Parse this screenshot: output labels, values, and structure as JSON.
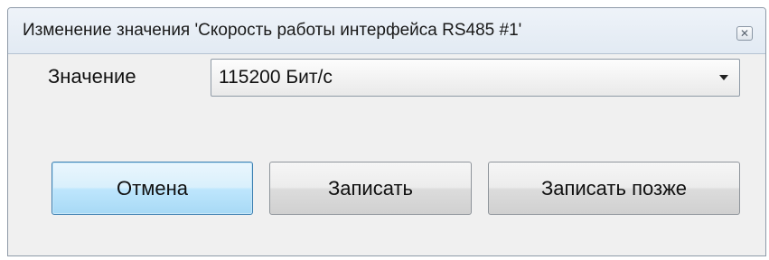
{
  "window": {
    "title": "Изменение значения 'Скорость работы интерфейса RS485 #1'",
    "close_icon": "close-icon"
  },
  "form": {
    "value_label": "Значение",
    "value_selected": "115200 Бит/с",
    "dropdown_icon": "chevron-down-icon"
  },
  "buttons": {
    "cancel": "Отмена",
    "write": "Записать",
    "write_later": "Записать позже"
  },
  "colors": {
    "default_button": "#bee6fd",
    "titlebar": "#e2eaf3",
    "window_bg": "#f0f0f0"
  }
}
